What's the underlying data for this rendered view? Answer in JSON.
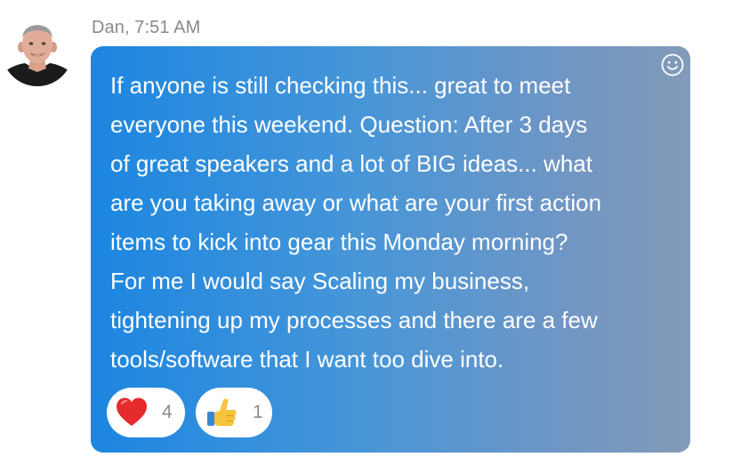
{
  "message": {
    "author": "Dan",
    "time": "7:51 AM",
    "header_text": "Dan, 7:51 AM",
    "lines": [
      "If anyone is still checking this... great to meet",
      "everyone this weekend. Question: After 3 days",
      "of great speakers and a lot of BIG ideas... what",
      "are you taking away or what are your first action",
      "items to kick into gear this Monday morning?",
      "For me I would say Scaling my business,",
      "tightening up my processes and there are a few",
      "tools/software that I want too dive into."
    ],
    "add_reaction_icon": "smiley-icon"
  },
  "reactions": [
    {
      "icon": "heart-icon",
      "count": "4"
    },
    {
      "icon": "thumbs-up-icon",
      "count": "1"
    }
  ],
  "colors": {
    "bubble_start": "#1c86e1",
    "bubble_end": "#829bb8",
    "meta_text": "#8a8a8a",
    "message_text": "#ffffff"
  }
}
